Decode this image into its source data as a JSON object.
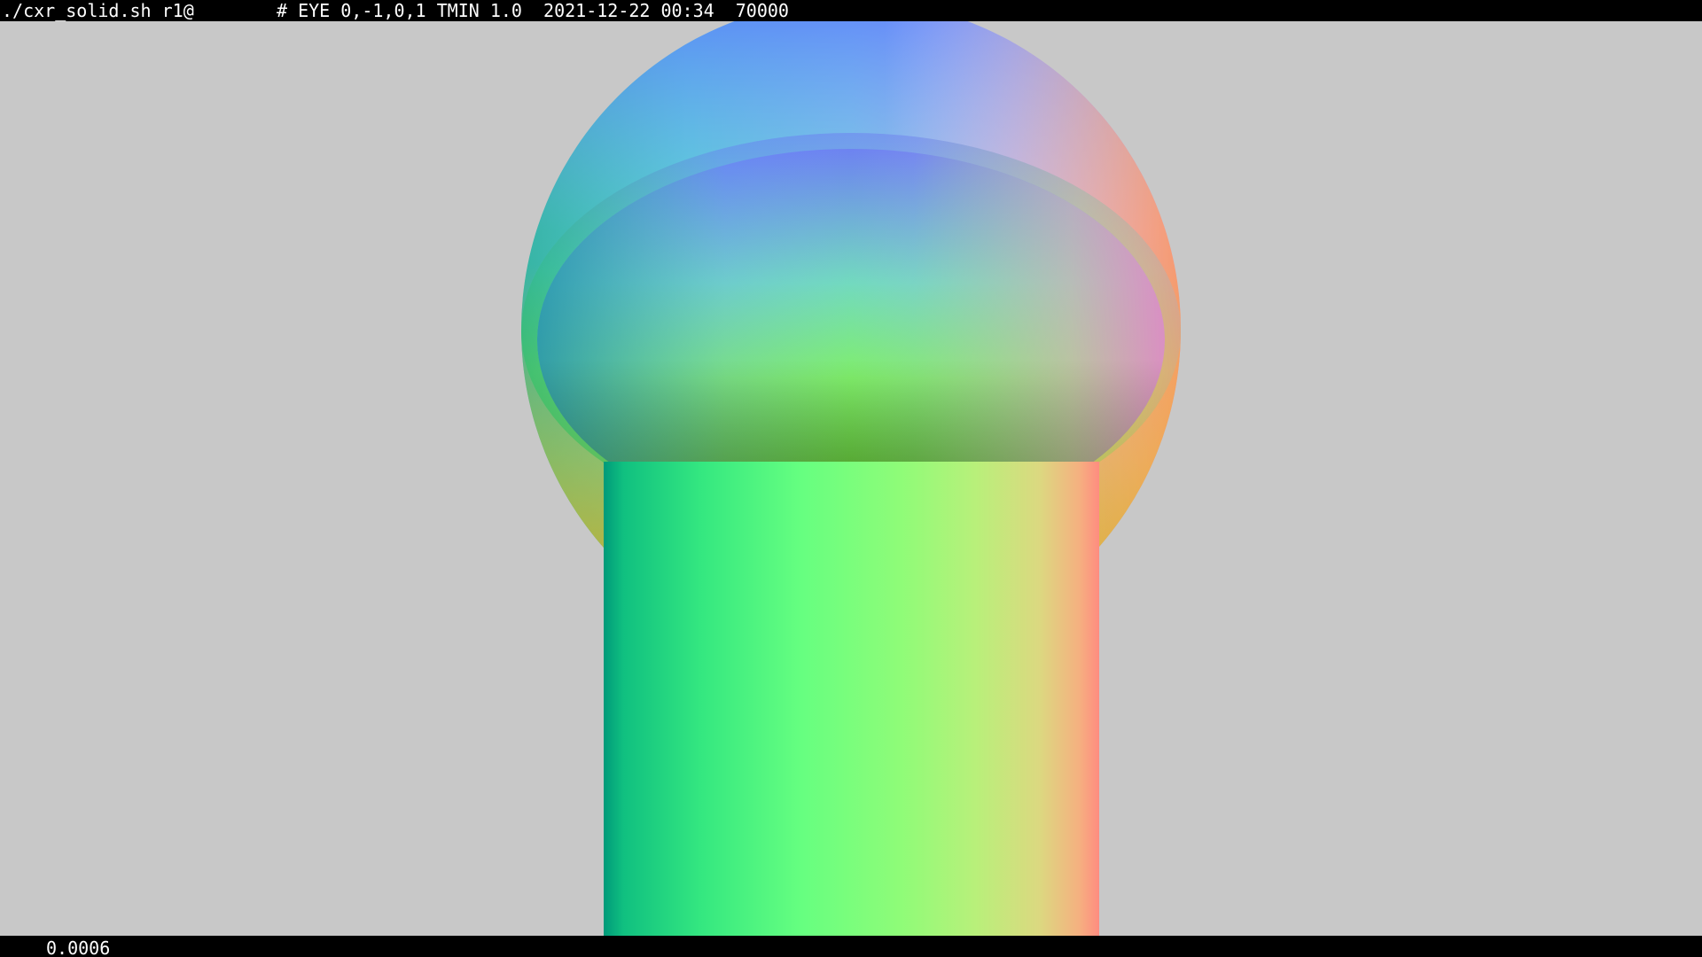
{
  "title_bar": {
    "command": "./cxr_solid.sh r1@",
    "info": "# EYE 0,-1,0,1 TMIN 1.0  2021-12-22 00:34  70000"
  },
  "status_bar": {
    "value": "0.0006"
  },
  "render": {
    "background_color": "#c8c8c8",
    "bar_color": "#000000",
    "shading": "surface-normal rainbow",
    "objects": [
      "sphere",
      "inner-ellipsoid",
      "cylinder"
    ]
  }
}
